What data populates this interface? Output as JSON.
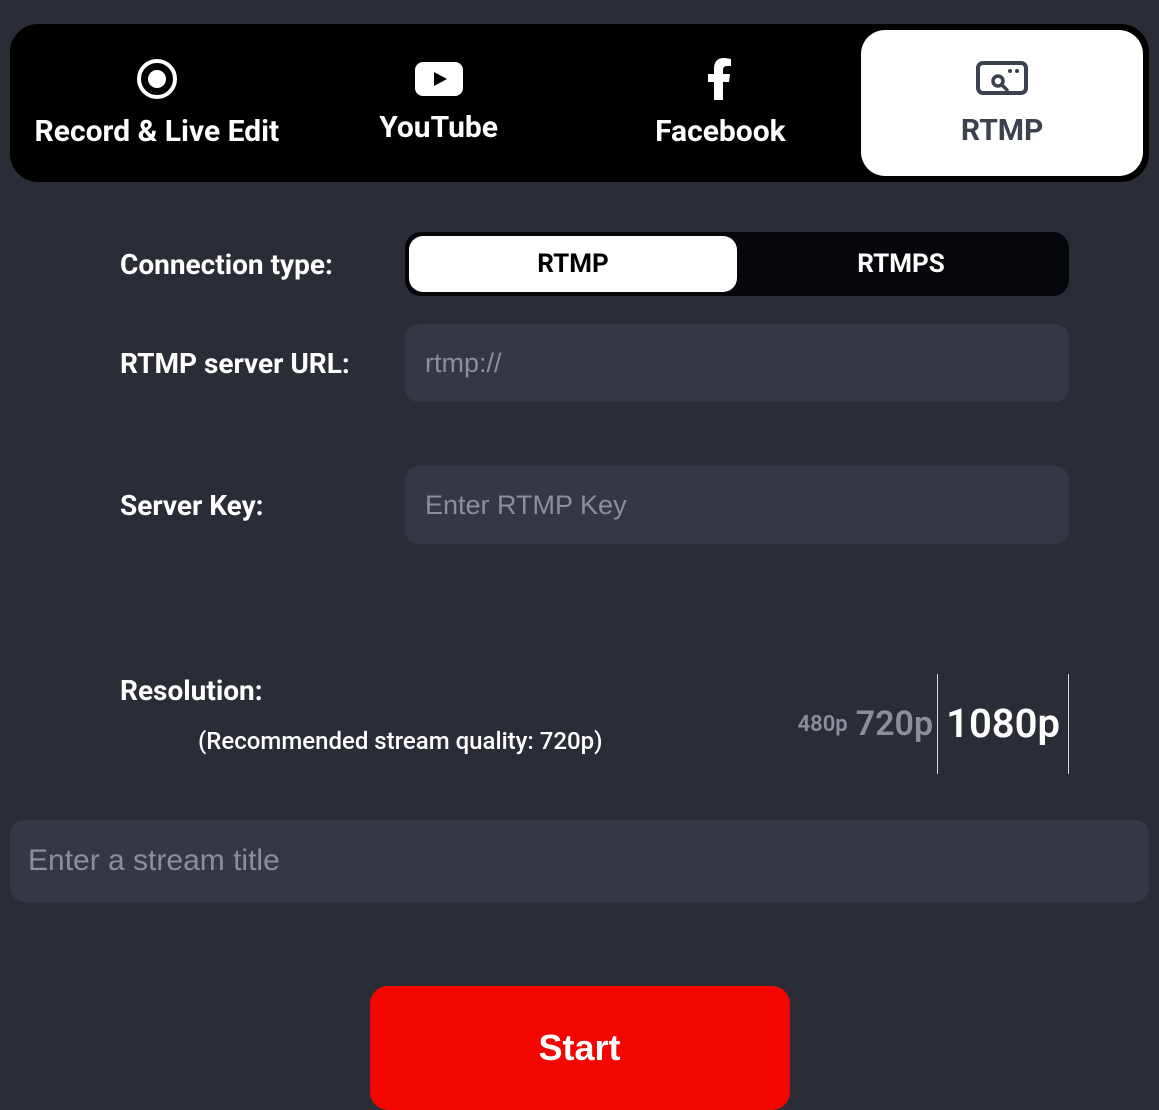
{
  "tabs": [
    {
      "label": "Record & Live Edit"
    },
    {
      "label": "YouTube"
    },
    {
      "label": "Facebook"
    },
    {
      "label": "RTMP"
    }
  ],
  "form": {
    "connection_type_label": "Connection type:",
    "conn_opts": {
      "rtmp": "RTMP",
      "rtmps": "RTMPS"
    },
    "server_url_label": "RTMP server URL:",
    "server_url_placeholder": "rtmp://",
    "server_url_value": "",
    "server_key_label": "Server Key:",
    "server_key_placeholder": "Enter RTMP Key",
    "server_key_value": "",
    "resolution_label": "Resolution:",
    "resolution_hint": "(Recommended stream quality: 720p)",
    "res_opts": {
      "r480": "480p",
      "r720": "720p",
      "r1080": "1080p"
    },
    "title_placeholder": "Enter a stream title",
    "title_value": "",
    "start_label": "Start"
  }
}
